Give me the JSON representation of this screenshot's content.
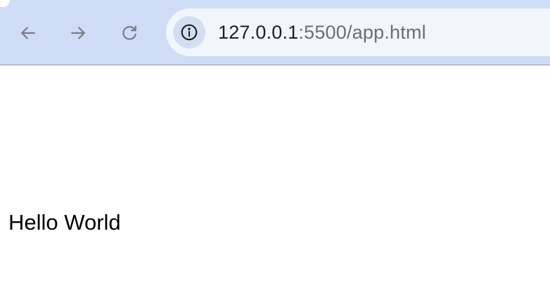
{
  "browser": {
    "icons": {
      "back": "arrow-left-icon",
      "forward": "arrow-right-icon",
      "reload": "reload-icon",
      "site_info": "info-icon"
    },
    "address_bar": {
      "host": "127.0.0.1",
      "rest": ":5500/app.html"
    },
    "colors": {
      "toolbar_bg": "#cfdcf5",
      "omnibox_bg": "#f1f5fc",
      "icon_gray": "#6f7378"
    }
  },
  "page": {
    "text": "Hello World"
  }
}
